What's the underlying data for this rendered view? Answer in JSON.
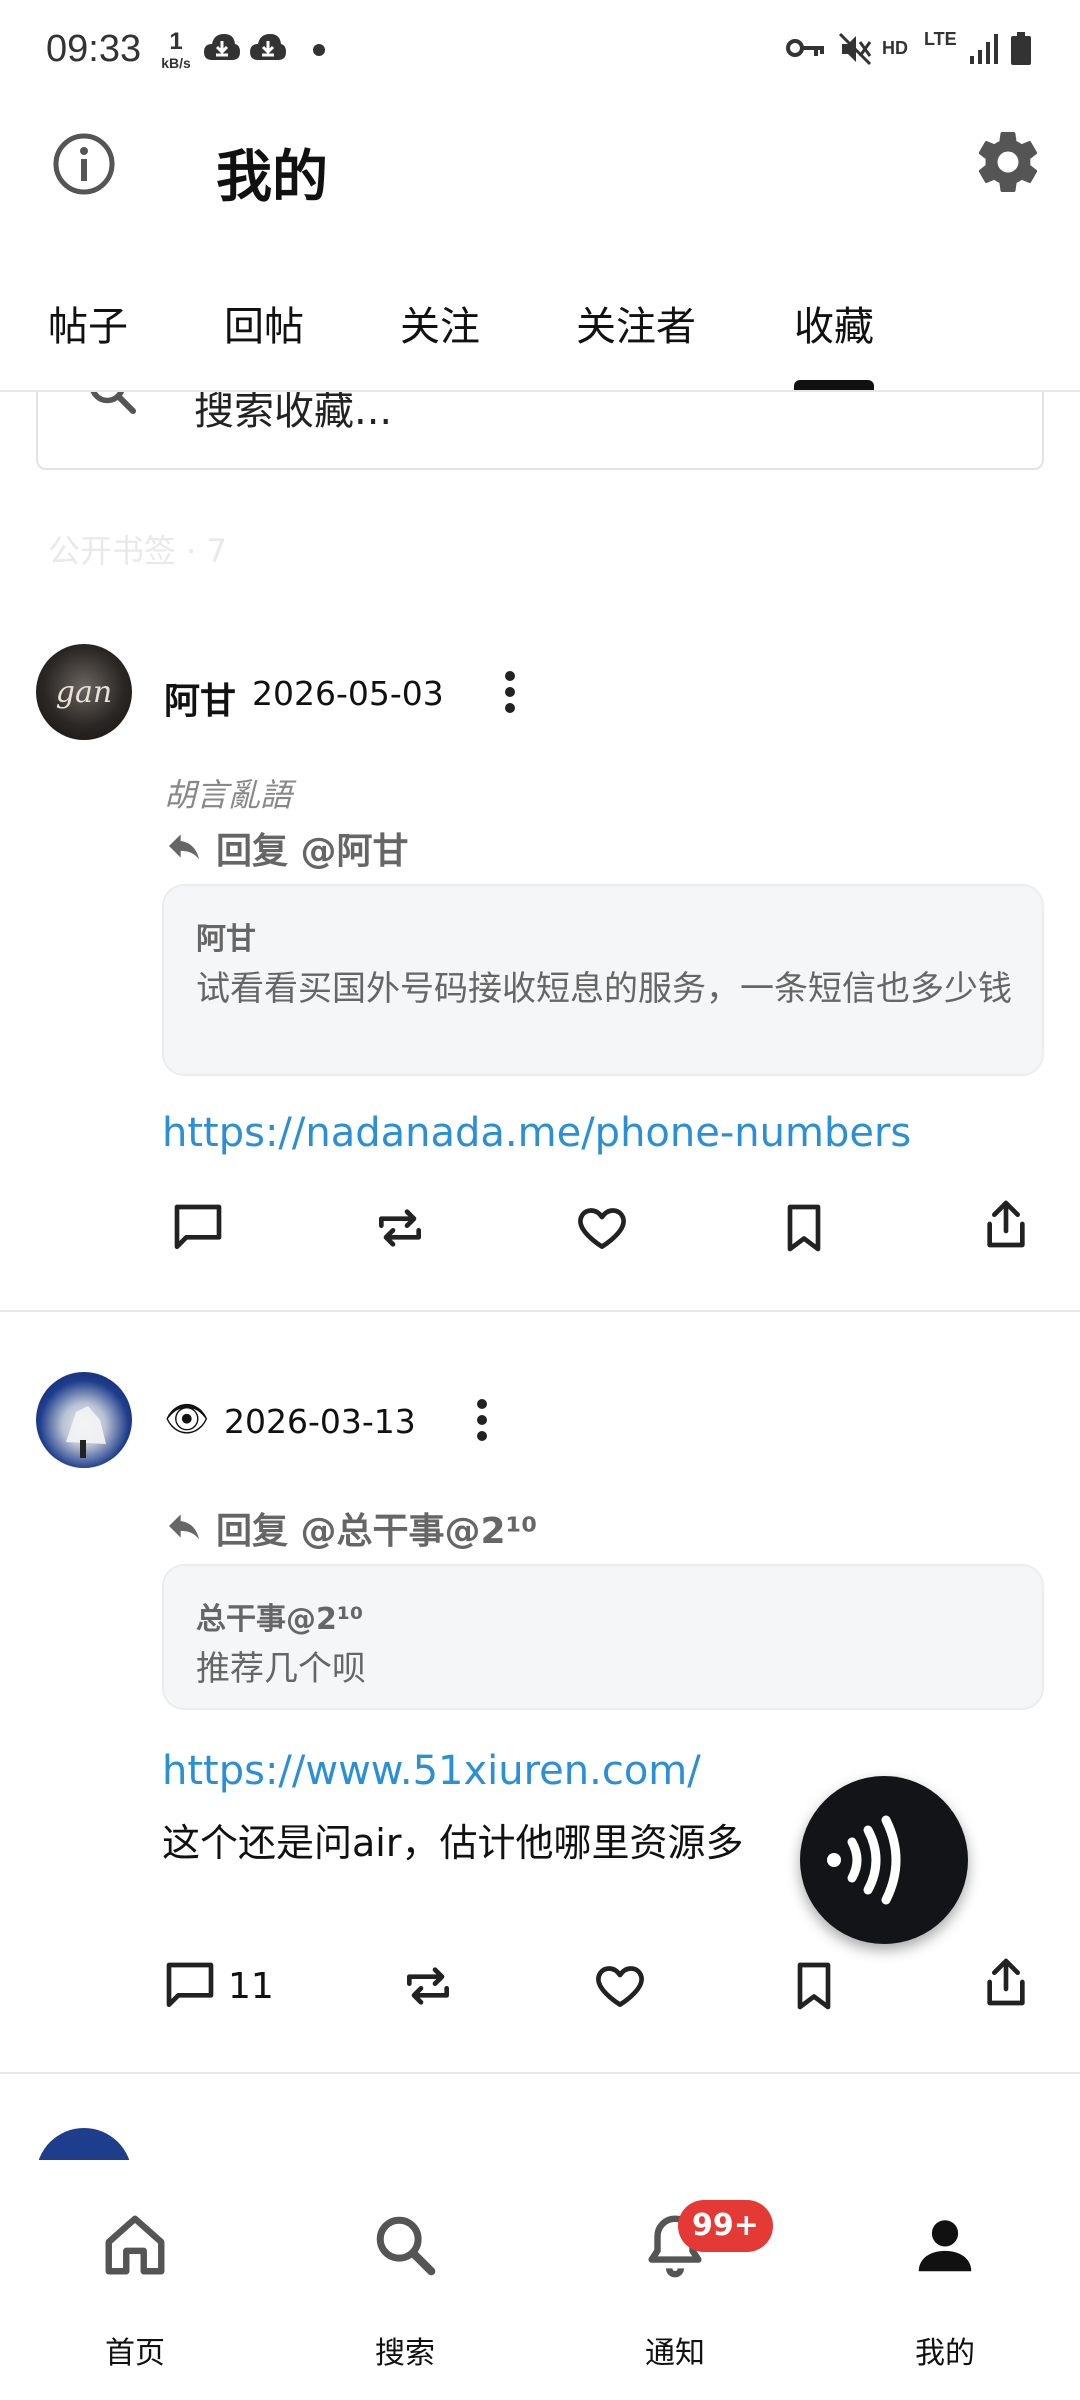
{
  "status_bar": {
    "time": "09:33",
    "speed_value": "1",
    "speed_unit": "kB/s",
    "hd_label": "HD",
    "lte_label": "LTE"
  },
  "header": {
    "title": "我的",
    "info_icon": "info-icon",
    "settings_icon": "gear-icon"
  },
  "tabs": [
    {
      "label": "帖子"
    },
    {
      "label": "回帖"
    },
    {
      "label": "关注"
    },
    {
      "label": "关注者"
    },
    {
      "label": "收藏",
      "active": true
    }
  ],
  "search": {
    "placeholder": "搜索收藏..."
  },
  "section_label": "公开书签 · 7",
  "posts": [
    {
      "author": "阿甘",
      "date": "2026-05-03",
      "subtitle": "胡言亂語",
      "reply_to": "回复 @阿甘",
      "quote_author": "阿甘",
      "quote_text": "试看看买国外号码接收短息的服务，一条短信也多少钱",
      "link": "https://nadanada.me/phone-numbers"
    },
    {
      "author_icon": "👁",
      "date": "2026-03-13",
      "reply_to": "回复 @总干事@2¹⁰",
      "quote_author": "总干事@2¹⁰",
      "quote_text": "推荐几个呗",
      "link": "https://www.51xiuren.com/",
      "body": "这个还是问air，估计他哪里资源多",
      "comment_count": "11"
    }
  ],
  "bottom_nav": [
    {
      "label": "首页",
      "icon": "home-icon"
    },
    {
      "label": "搜索",
      "icon": "search-icon"
    },
    {
      "label": "通知",
      "icon": "bell-icon",
      "badge": "99+"
    },
    {
      "label": "我的",
      "icon": "person-icon",
      "active": true
    }
  ],
  "colors": {
    "link": "#2a8fd6",
    "badge": "#e53935",
    "fab": "#121417"
  }
}
